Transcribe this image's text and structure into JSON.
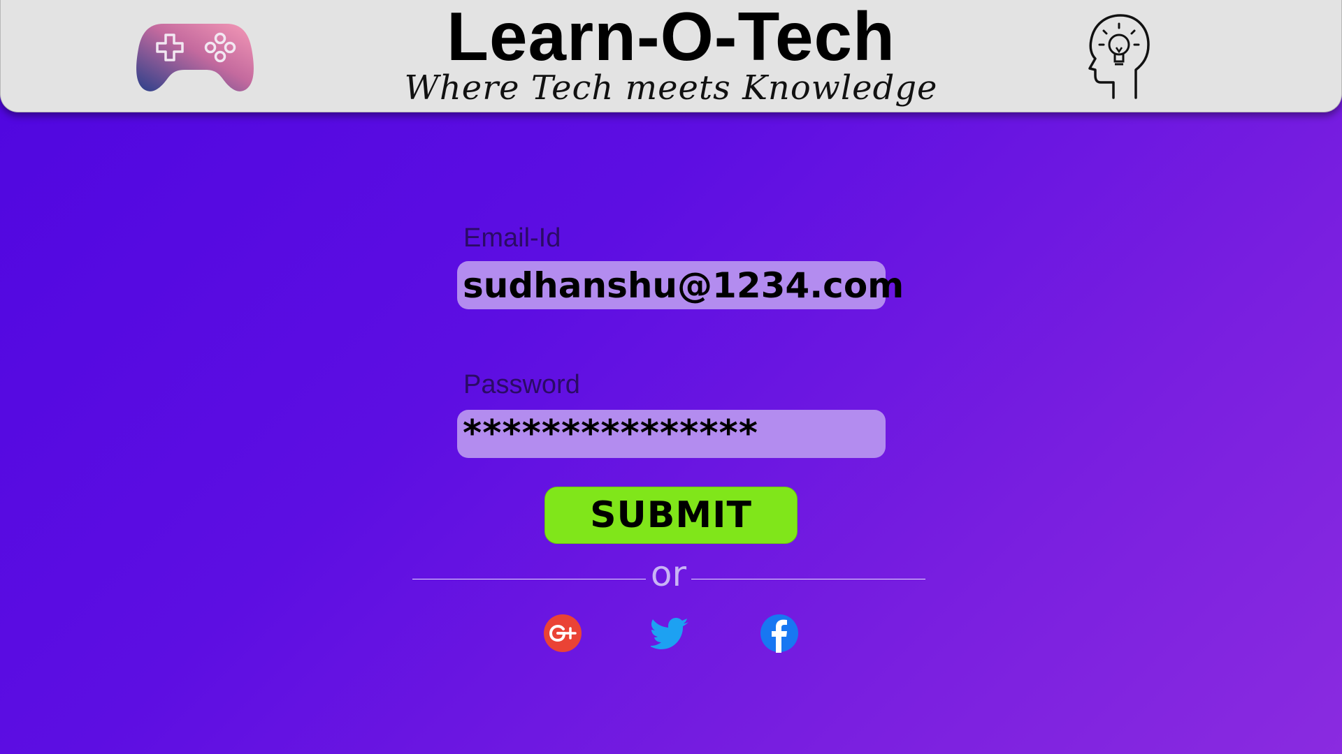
{
  "header": {
    "title": "Learn-O-Tech",
    "tagline": "Where Tech meets Knowledge",
    "left_logo_icon": "gamepad-icon",
    "right_logo_icon": "head-lightbulb-icon",
    "background_color": "#e3e3e3"
  },
  "form": {
    "email_label": "Email-Id",
    "email_value": "sudhanshu@1234.com",
    "password_label": "Password",
    "password_value": "***************",
    "submit_label": "SUBMIT",
    "divider_text": "or",
    "input_background": "#b38cef",
    "submit_color": "#80e61a"
  },
  "social": [
    {
      "name": "google-plus-icon",
      "color": "#ea4335"
    },
    {
      "name": "twitter-icon",
      "color": "#1da1f2"
    },
    {
      "name": "facebook-icon",
      "color": "#1877f2"
    }
  ],
  "background_gradient": [
    "#4f06e0",
    "#8a2be0"
  ]
}
